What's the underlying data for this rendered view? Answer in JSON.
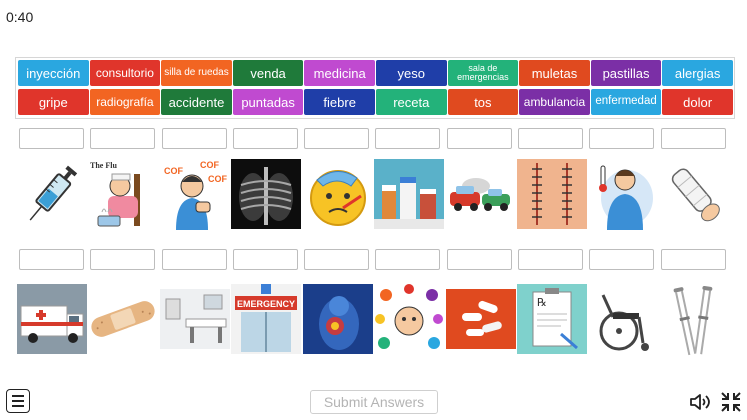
{
  "timer": "0:40",
  "colors": {
    "cyan": "#2aa7e0",
    "red": "#e0352b",
    "orange": "#f26522",
    "green": "#1f7a3a",
    "magenta": "#c04ad0",
    "blue": "#1f3ea8",
    "teal": "#23b27a",
    "purple": "#7b2fa6"
  },
  "word_bank": {
    "row1": [
      {
        "label": "inyección",
        "color": "#2aa7e0"
      },
      {
        "label": "consultorio",
        "color": "#e0352b"
      },
      {
        "label": "silla de ruedas",
        "color": "#f26522"
      },
      {
        "label": "venda",
        "color": "#1f7a3a"
      },
      {
        "label": "medicina",
        "color": "#c04ad0"
      },
      {
        "label": "yeso",
        "color": "#1f3ea8"
      },
      {
        "label": "sala de emergencias",
        "color": "#23b27a"
      },
      {
        "label": "muletas",
        "color": "#e04a1f"
      },
      {
        "label": "pastillas",
        "color": "#7b2fa6"
      },
      {
        "label": "alergias",
        "color": "#2aa7e0"
      }
    ],
    "row2": [
      {
        "label": "gripe",
        "color": "#e0352b"
      },
      {
        "label": "radiografía",
        "color": "#f26522"
      },
      {
        "label": "accidente",
        "color": "#1f7a3a"
      },
      {
        "label": "puntadas",
        "color": "#c04ad0"
      },
      {
        "label": "fiebre",
        "color": "#1f3ea8"
      },
      {
        "label": "receta",
        "color": "#23b27a"
      },
      {
        "label": "tos",
        "color": "#e04a1f"
      },
      {
        "label": "ambulancia",
        "color": "#7b2fa6"
      },
      {
        "label": "enfermedad",
        "color": "#2aa7e0"
      },
      {
        "label": "dolor",
        "color": "#e0352b"
      }
    ]
  },
  "images_top": [
    "syringe",
    "flu-sick-person",
    "coughing-person",
    "chest-xray",
    "sick-emoji-thermometer",
    "medicine-bottles",
    "car-accident",
    "stitches",
    "fever-person",
    "arm-cast"
  ],
  "images_bottom": [
    "ambulance",
    "bandage",
    "doctor-office",
    "emergency-room",
    "back-pain",
    "allergies",
    "pills",
    "prescription",
    "wheelchair",
    "crutches"
  ],
  "image_text": {
    "flu_caption": "The Flu",
    "cough_text": "COF",
    "emergency_sign": "EMERGENCY",
    "rx_symbol": "℞"
  },
  "submit_label": "Submit Answers"
}
